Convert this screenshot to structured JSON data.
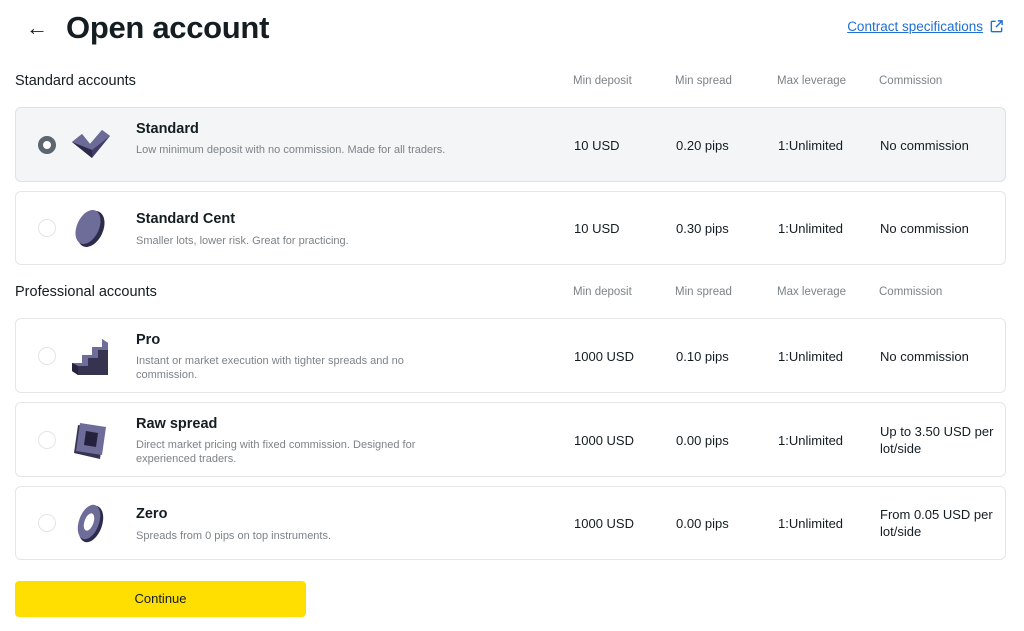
{
  "header": {
    "title": "Open account",
    "back_icon": "arrow-left-icon",
    "spec_link": "Contract specifications",
    "spec_icon": "external-link-icon",
    "link_color": "#1f6fd6"
  },
  "columns": {
    "min_deposit": "Min deposit",
    "min_spread": "Min spread",
    "max_leverage": "Max leverage",
    "commission": "Commission"
  },
  "standard_section": {
    "title": "Standard accounts",
    "accounts": [
      {
        "name": "Standard",
        "description": "Low minimum deposit with no commission. Made for all traders.",
        "min_deposit": "10 USD",
        "min_spread": "0.20 pips",
        "max_leverage": "1:Unlimited",
        "commission": "No commission",
        "selected": true,
        "icon": "chevron-block-icon"
      },
      {
        "name": "Standard Cent",
        "description": "Smaller lots, lower risk. Great for practicing.",
        "min_deposit": "10 USD",
        "min_spread": "0.30 pips",
        "max_leverage": "1:Unlimited",
        "commission": "No commission",
        "selected": false,
        "icon": "coin-icon"
      }
    ]
  },
  "professional_section": {
    "title": "Professional accounts",
    "accounts": [
      {
        "name": "Pro",
        "description": "Instant or market execution with tighter spreads and no commission.",
        "min_deposit": "1000 USD",
        "min_spread": "0.10 pips",
        "max_leverage": "1:Unlimited",
        "commission": "No commission",
        "selected": false,
        "icon": "stairs-icon"
      },
      {
        "name": "Raw spread",
        "description": "Direct market pricing with fixed commission. Designed for experienced traders.",
        "min_deposit": "1000 USD",
        "min_spread": "0.00 pips",
        "max_leverage": "1:Unlimited",
        "commission": "Up to 3.50 USD per lot/side",
        "selected": false,
        "icon": "frame-icon"
      },
      {
        "name": "Zero",
        "description": "Spreads from 0 pips on top instruments.",
        "min_deposit": "1000 USD",
        "min_spread": "0.00 pips",
        "max_leverage": "1:Unlimited",
        "commission": "From 0.05 USD per lot/side",
        "selected": false,
        "icon": "ring-icon"
      }
    ]
  },
  "continue_button": {
    "label": "Continue",
    "color": "#ffde02"
  }
}
